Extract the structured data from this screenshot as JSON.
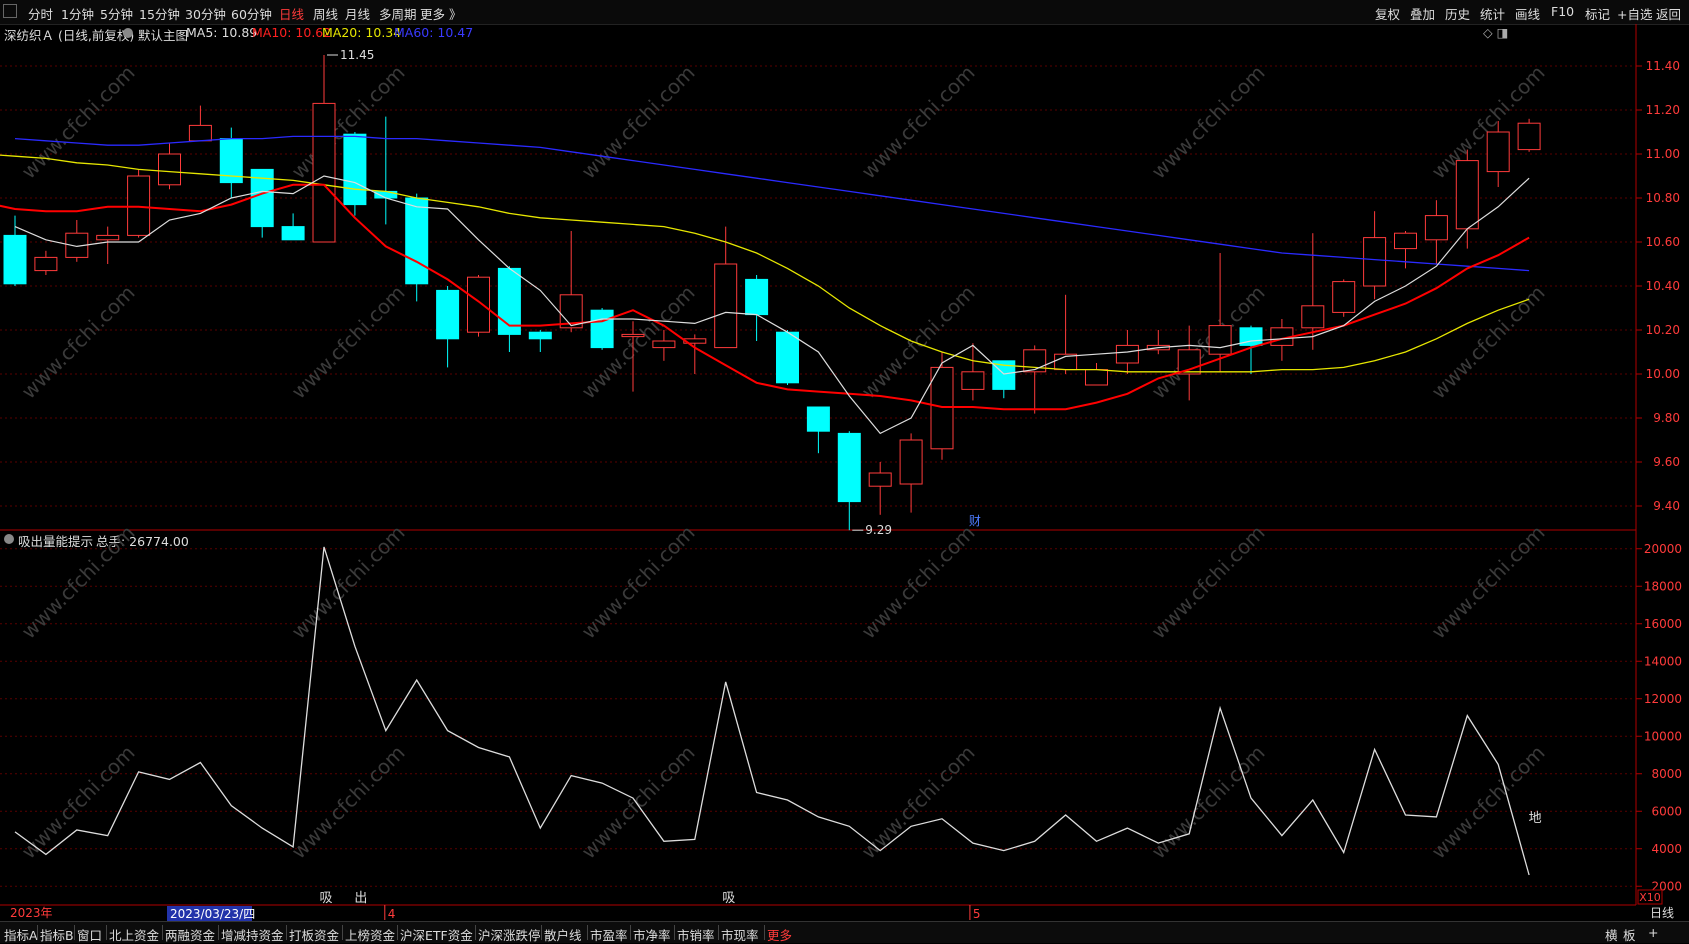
{
  "toolbar": {
    "periods": [
      "分时",
      "1分钟",
      "5分钟",
      "15分钟",
      "30分钟",
      "60分钟",
      "日线",
      "周线",
      "月线",
      "多周期",
      "更多 》"
    ],
    "active_period": "日线",
    "right_buttons": [
      "复权",
      "叠加",
      "历史",
      "统计",
      "画线",
      "F10",
      "标记",
      "+自选",
      "返回"
    ]
  },
  "info": {
    "stock": "深纺织Ａ (日线,前复权)",
    "main_chart": "默认主图",
    "ma5": "MA5: 10.89",
    "ma10": "MA10: 10.62",
    "ma20": "MA20: 10.34",
    "ma60": "MA60: 10.47",
    "top_right_icons": "◇ ◨"
  },
  "indicator": {
    "name": "吸出量能提示",
    "total": "总手: 26774.00",
    "marks": [
      "吸",
      "出",
      "吸",
      "地"
    ]
  },
  "price_axis": [
    "11.40",
    "11.20",
    "11.00",
    "10.80",
    "10.60",
    "10.40",
    "10.20",
    "10.00",
    "9.80",
    "9.60",
    "9.40"
  ],
  "vol_axis": [
    "20000",
    "18000",
    "16000",
    "14000",
    "12000",
    "10000",
    "8000",
    "6000",
    "4000",
    "2000"
  ],
  "annotations": {
    "high": "11.45",
    "low": "9.29",
    "event": "财",
    "multiplier": "X10"
  },
  "date_axis": {
    "year": "2023年",
    "cursor_date": "2023/03/23/四",
    "month4": "4",
    "month5": "5",
    "period_label": "日线"
  },
  "bottom_tabs": [
    "指标A",
    "指标B",
    "窗口",
    "北上资金",
    "两融资金",
    "增减持资金",
    "打板资金",
    "上榜资金",
    "沪深ETF资金",
    "沪深涨跌停",
    "散户线",
    "市盈率",
    "市净率",
    "市销率",
    "市现率",
    "更多"
  ],
  "bottom_right": [
    "横",
    "板",
    "+"
  ],
  "watermark": "www.cfchi.com",
  "colors": {
    "up": "#ff3b3b",
    "down": "#00ffff",
    "ma5": "#dddddd",
    "ma10": "#ff0000",
    "ma20": "#e6e600",
    "ma60": "#2a2aff"
  },
  "chart_data": {
    "type": "candlestick",
    "ylim": [
      9.3,
      11.5
    ],
    "candles": [
      [
        10.63,
        10.41,
        10.72,
        10.4
      ],
      [
        10.47,
        10.53,
        10.56,
        10.45
      ],
      [
        10.53,
        10.64,
        10.7,
        10.51
      ],
      [
        10.61,
        10.63,
        10.67,
        10.5
      ],
      [
        10.63,
        10.9,
        10.93,
        10.62
      ],
      [
        10.86,
        11.0,
        11.05,
        10.84
      ],
      [
        11.06,
        11.13,
        11.22,
        11.06
      ],
      [
        11.07,
        10.87,
        11.12,
        10.8
      ],
      [
        10.93,
        10.67,
        10.93,
        10.62
      ],
      [
        10.67,
        10.61,
        10.73,
        10.61
      ],
      [
        10.6,
        11.23,
        11.45,
        10.6
      ],
      [
        11.09,
        10.77,
        11.1,
        10.72
      ],
      [
        10.83,
        10.8,
        11.17,
        10.68
      ],
      [
        10.8,
        10.41,
        10.82,
        10.33
      ],
      [
        10.38,
        10.16,
        10.4,
        10.03
      ],
      [
        10.19,
        10.44,
        10.45,
        10.17
      ],
      [
        10.48,
        10.18,
        10.49,
        10.1
      ],
      [
        10.19,
        10.16,
        10.2,
        10.1
      ],
      [
        10.21,
        10.36,
        10.65,
        10.19
      ],
      [
        10.29,
        10.12,
        10.3,
        10.11
      ],
      [
        10.17,
        10.18,
        10.24,
        9.92
      ],
      [
        10.12,
        10.15,
        10.2,
        10.06
      ],
      [
        10.14,
        10.16,
        10.18,
        10.0
      ],
      [
        10.12,
        10.5,
        10.67,
        10.12
      ],
      [
        10.43,
        10.27,
        10.45,
        10.15
      ],
      [
        10.19,
        9.96,
        10.2,
        9.95
      ],
      [
        9.85,
        9.74,
        9.85,
        9.64
      ],
      [
        9.73,
        9.42,
        9.74,
        9.29
      ],
      [
        9.49,
        9.55,
        9.6,
        9.36
      ],
      [
        9.5,
        9.7,
        9.73,
        9.37
      ],
      [
        9.66,
        10.03,
        10.1,
        9.61
      ],
      [
        9.93,
        10.01,
        10.14,
        9.88
      ],
      [
        10.06,
        9.93,
        10.06,
        9.89
      ],
      [
        10.01,
        10.11,
        10.13,
        9.82
      ],
      [
        10.02,
        10.09,
        10.36,
        10.0
      ],
      [
        9.95,
        10.02,
        10.05,
        9.97
      ],
      [
        10.05,
        10.13,
        10.2,
        10.0
      ],
      [
        10.11,
        10.13,
        10.2,
        10.09
      ],
      [
        10.0,
        10.11,
        10.22,
        9.88
      ],
      [
        10.09,
        10.22,
        10.55,
        10.01
      ],
      [
        10.21,
        10.13,
        10.22,
        10.0
      ],
      [
        10.13,
        10.21,
        10.25,
        10.06
      ],
      [
        10.21,
        10.31,
        10.64,
        10.11
      ],
      [
        10.28,
        10.42,
        10.43,
        10.26
      ],
      [
        10.4,
        10.62,
        10.74,
        10.34
      ],
      [
        10.57,
        10.64,
        10.65,
        10.48
      ],
      [
        10.61,
        10.72,
        10.79,
        10.5
      ],
      [
        10.66,
        10.97,
        11.02,
        10.57
      ],
      [
        10.92,
        11.1,
        11.15,
        10.85
      ],
      [
        11.02,
        11.14,
        11.16,
        11.01
      ]
    ],
    "ma5": [
      10.67,
      10.61,
      10.58,
      10.6,
      10.6,
      10.7,
      10.73,
      10.8,
      10.83,
      10.82,
      10.9,
      10.87,
      10.8,
      10.76,
      10.75,
      10.61,
      10.48,
      10.38,
      10.22,
      10.25,
      10.25,
      10.24,
      10.23,
      10.28,
      10.27,
      10.19,
      10.1,
      9.9,
      9.73,
      9.8,
      10.05,
      10.13,
      10.0,
      10.02,
      10.08,
      10.09,
      10.1,
      10.12,
      10.13,
      10.12,
      10.15,
      10.16,
      10.17,
      10.22,
      10.33,
      10.4,
      10.49,
      10.66,
      10.76,
      10.89
    ],
    "ma10": [
      10.89,
      10.84,
      10.78,
      10.75,
      10.74,
      10.74,
      10.76,
      10.76,
      10.75,
      10.74,
      10.77,
      10.82,
      10.86,
      10.86,
      10.71,
      10.58,
      10.51,
      10.43,
      10.33,
      10.22,
      10.22,
      10.23,
      10.24,
      10.29,
      10.22,
      10.12,
      10.04,
      9.96,
      9.93,
      9.92,
      9.91,
      9.9,
      9.88,
      9.85,
      9.85,
      9.84,
      9.84,
      9.84,
      9.87,
      9.91,
      9.98,
      10.02,
      10.07,
      10.12,
      10.16,
      10.19,
      10.22,
      10.27,
      10.32,
      10.39,
      10.48,
      10.54,
      10.62
    ],
    "ma20": [
      11.0,
      10.99,
      10.98,
      10.96,
      10.95,
      10.93,
      10.92,
      10.91,
      10.9,
      10.89,
      10.88,
      10.86,
      10.84,
      10.83,
      10.8,
      10.78,
      10.76,
      10.73,
      10.71,
      10.7,
      10.69,
      10.68,
      10.67,
      10.64,
      10.6,
      10.55,
      10.48,
      10.4,
      10.3,
      10.22,
      10.15,
      10.1,
      10.06,
      10.04,
      10.03,
      10.02,
      10.02,
      10.01,
      10.01,
      10.01,
      10.01,
      10.01,
      10.02,
      10.02,
      10.03,
      10.06,
      10.1,
      10.16,
      10.23,
      10.29,
      10.34
    ],
    "ma60": [
      11.07,
      11.06,
      11.05,
      11.04,
      11.04,
      11.05,
      11.06,
      11.07,
      11.07,
      11.08,
      11.08,
      11.08,
      11.07,
      11.07,
      11.06,
      11.05,
      11.04,
      11.03,
      11.01,
      10.99,
      10.97,
      10.95,
      10.93,
      10.91,
      10.89,
      10.87,
      10.85,
      10.83,
      10.81,
      10.79,
      10.77,
      10.75,
      10.73,
      10.71,
      10.69,
      10.67,
      10.65,
      10.63,
      10.61,
      10.59,
      10.57,
      10.55,
      10.54,
      10.53,
      10.52,
      10.51,
      10.5,
      10.49,
      10.48,
      10.47
    ],
    "indicator": [
      4900,
      3700,
      5000,
      4700,
      8100,
      7700,
      8600,
      6300,
      5100,
      4100,
      20100,
      14800,
      10300,
      13000,
      10300,
      9400,
      8900,
      5100,
      7900,
      7500,
      6700,
      4400,
      4500,
      12900,
      7000,
      6600,
      5700,
      5200,
      3900,
      5200,
      5600,
      4300,
      3900,
      4400,
      5800,
      4400,
      5100,
      4300,
      4800,
      11500,
      6700,
      4700,
      6600,
      3800,
      9300,
      5800,
      5700,
      11100,
      8500,
      2600
    ],
    "indicator_ylim": [
      1000,
      21000
    ]
  }
}
